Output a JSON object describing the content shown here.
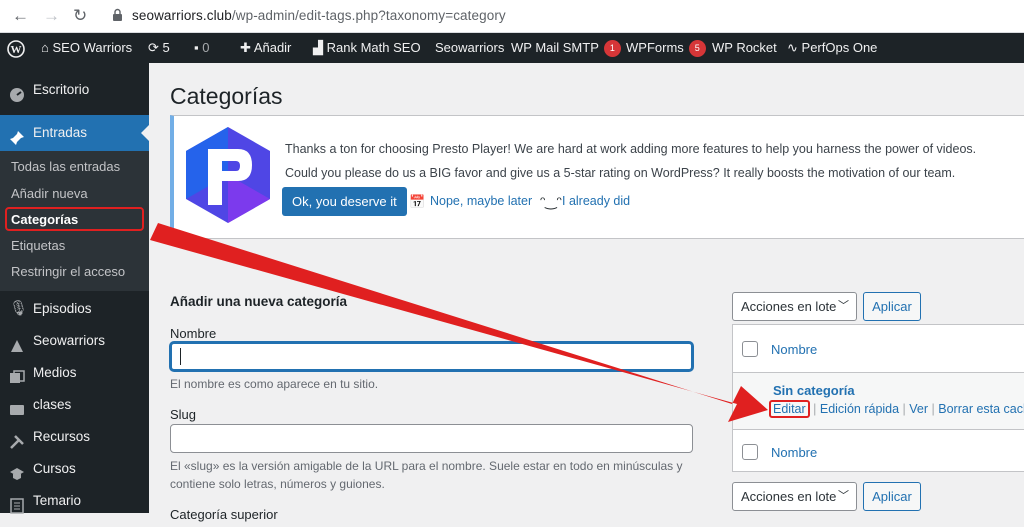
{
  "browser": {
    "url_host": "seowarriors.club",
    "url_path": "/wp-admin/edit-tags.php?taxonomy=category"
  },
  "adminbar": {
    "site": "SEO Warriors",
    "updates": "5",
    "comments": "0",
    "new": "Añadir",
    "items": [
      "Rank Math SEO",
      "Seowarriors",
      "WP Mail SMTP",
      "WPForms",
      "WP Rocket",
      "PerfOps One"
    ],
    "wpmail_badge": "1",
    "wpforms_badge": "5"
  },
  "sidebar": {
    "escritorio": "Escritorio",
    "entradas": "Entradas",
    "sub": [
      "Todas las entradas",
      "Añadir nueva",
      "Categorías",
      "Etiquetas",
      "Restringir el acceso"
    ],
    "items": [
      "Episodios",
      "Seowarriors",
      "Medios",
      "clases",
      "Recursos",
      "Cursos",
      "Temario"
    ]
  },
  "page": {
    "title": "Categorías"
  },
  "notice": {
    "line1": "Thanks a ton for choosing Presto Player! We are hard at work adding more features to help you harness the power of videos.",
    "line2": "Could you please do us a BIG favor and give us a 5-star rating on WordPress? It really boosts the motivation of our team.",
    "ok": "Ok, you deserve it",
    "later": "Nope, maybe later",
    "done": "I already did"
  },
  "form": {
    "heading": "Añadir una nueva categoría",
    "name_label": "Nombre",
    "name_value": "",
    "name_help": "El nombre es como aparece en tu sitio.",
    "slug_label": "Slug",
    "slug_value": "",
    "slug_help1": "El «slug» es la versión amigable de la URL para el nombre. Suele estar en todo en minúsculas y",
    "slug_help2": "contiene solo letras, números y guiones.",
    "parent_label": "Categoría superior"
  },
  "table": {
    "bulk": "Acciones en lote",
    "apply": "Aplicar",
    "col_name": "Nombre",
    "row_title": "Sin categoría",
    "actions": [
      "Editar",
      "Edición rápida",
      "Ver",
      "Borrar esta caché"
    ]
  },
  "colors": {
    "accent": "#2271b1",
    "adminbar": "#1d2327",
    "annotation": "#e02020"
  }
}
